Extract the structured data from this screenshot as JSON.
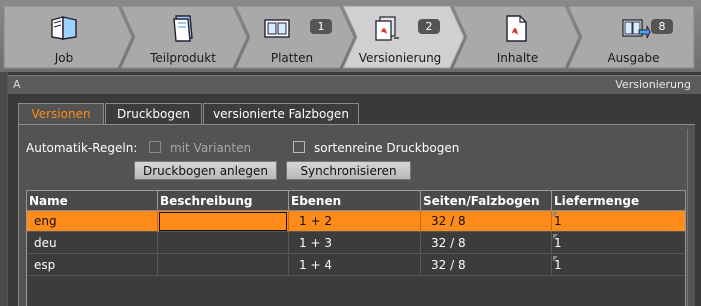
{
  "workflow": {
    "steps": [
      {
        "label": "Job",
        "badge": "",
        "icon": "job-icon",
        "active": false
      },
      {
        "label": "Teilprodukt",
        "badge": "",
        "icon": "part-product-icon",
        "active": false
      },
      {
        "label": "Platten",
        "badge": "1",
        "icon": "plates-icon",
        "active": false
      },
      {
        "label": "Versionierung",
        "badge": "2",
        "icon": "versioning-icon",
        "active": true
      },
      {
        "label": "Inhalte",
        "badge": "",
        "icon": "pdf-content-icon",
        "active": false
      },
      {
        "label": "Ausgabe",
        "badge": "8",
        "icon": "output-icon",
        "active": false
      }
    ]
  },
  "panel": {
    "left_label": "A",
    "title": "Versionierung"
  },
  "tabs": [
    {
      "label": "Versionen",
      "active": true
    },
    {
      "label": "Druckbogen",
      "active": false
    },
    {
      "label": "versionierte Falzbogen",
      "active": false
    }
  ],
  "rules": {
    "label": "Automatik-Regeln:",
    "with_variants": {
      "label": "mit Varianten",
      "checked": false,
      "enabled": false
    },
    "sorted_sheets": {
      "label": "sortenreine Druckbogen",
      "checked": false,
      "enabled": true
    }
  },
  "buttons": {
    "create_sheets": "Druckbogen anlegen",
    "synchronize": "Synchronisieren"
  },
  "table": {
    "columns": [
      "Name",
      "Beschreibung",
      "Ebenen",
      "Seiten/Falzbogen",
      "Liefermenge"
    ],
    "rows": [
      {
        "name": "eng",
        "description": "",
        "layers": "1 + 2",
        "pages": "32 / 8",
        "quantity": "1",
        "selected": true
      },
      {
        "name": "deu",
        "description": "",
        "layers": "1 + 3",
        "pages": "32 / 8",
        "quantity": "1",
        "selected": false
      },
      {
        "name": "esp",
        "description": "",
        "layers": "1 + 4",
        "pages": "32 / 8",
        "quantity": "1",
        "selected": false
      }
    ]
  },
  "colors": {
    "accent": "#ff8c1a",
    "background": "#3a3a3a",
    "panel": "#535353"
  }
}
